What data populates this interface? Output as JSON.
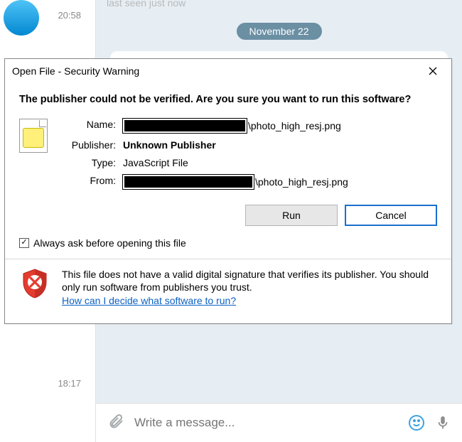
{
  "telegram": {
    "last_seen": "last seen just now",
    "time1": "20:58",
    "time2": "18:17",
    "date_pill": "November 22",
    "compose_placeholder": "Write a message..."
  },
  "dialog": {
    "title": "Open File - Security Warning",
    "heading": "The publisher could not be verified.  Are you sure you want to run this software?",
    "fields": {
      "name_label": "Name:",
      "name_suffix": "\\photo_high_resj.png",
      "publisher_label": "Publisher:",
      "publisher_value": "Unknown Publisher",
      "type_label": "Type:",
      "type_value": "JavaScript File",
      "from_label": "From:",
      "from_suffix": "\\photo_high_resj.png"
    },
    "buttons": {
      "run": "Run",
      "cancel": "Cancel"
    },
    "checkbox_label": "Always ask before opening this file",
    "warning_text": "This file does not have a valid digital signature that verifies its publisher.  You should only run software from publishers you trust.",
    "link_text": "How can I decide what software to run?"
  }
}
